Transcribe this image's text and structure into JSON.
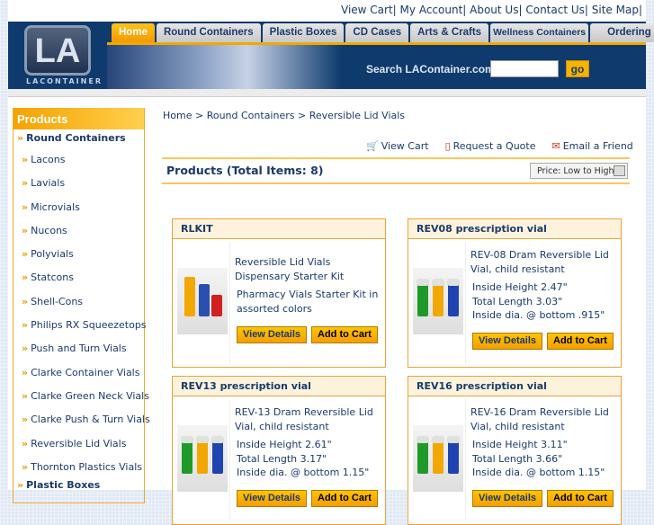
{
  "top_links": [
    "View Cart|",
    "My Account|",
    "About Us|",
    "Contact Us|",
    "Site Map|"
  ],
  "logo": {
    "mark": "LA",
    "text": "LACONTAINER"
  },
  "tabs": [
    "Home",
    "Round Containers",
    "Plastic Boxes",
    "CD Cases",
    "Arts & Crafts",
    "Wellness Containers",
    "Ordering"
  ],
  "search": {
    "label": "Search LAContainer.com",
    "value": "",
    "button": "go"
  },
  "sidebar": {
    "title": "Products",
    "category": "Round Containers",
    "items": [
      "Lacons",
      "Lavials",
      "Microvials",
      "Nucons",
      "Polyvials",
      "Statcons",
      "Shell-Cons",
      "Philips RX Squeezetops",
      "Push and Turn Vials",
      "Clarke Container Vials",
      "Clarke Green Neck Vials",
      "Clarke Push & Turn Vials",
      "Reversible Lid Vials",
      "Thornton Plastics Vials"
    ],
    "next_category": "Plastic Boxes"
  },
  "breadcrumb": "Home > Round Containers > Reversible Lid Vials",
  "actions": {
    "view_cart": "View Cart",
    "quote": "Request a Quote",
    "email": "Email a Friend"
  },
  "products_title": "Products (Total Items: 8)",
  "sort": "Price: Low to High",
  "buttons": {
    "details": "View Details",
    "cart": "Add to Cart"
  },
  "products": [
    {
      "code": "RLKIT",
      "name": "Reversible Lid Vials Dispensary Starter Kit",
      "specs": [
        "Pharmacy Vials Starter Kit in assorted colors"
      ]
    },
    {
      "code": "REV08 prescription vial",
      "name": "REV-08 Dram Reversible Lid Vial, child resistant",
      "specs": [
        "Inside Height 2.47\"",
        "Total Length 3.03\"",
        "Inside dia. @ bottom .915\""
      ]
    },
    {
      "code": "REV13 prescription vial",
      "name": "REV-13 Dram Reversible Lid Vial, child resistant",
      "specs": [
        "Inside Height 2.61\"",
        "Total Length 3.17\"",
        "Inside dia. @ bottom 1.15\""
      ]
    },
    {
      "code": "REV16 prescription vial",
      "name": "REV-16 Dram Reversible Lid Vial, child resistant",
      "specs": [
        "Inside Height 3.11\"",
        "Total Length 3.66\"",
        "Inside dia. @ bottom 1.15\""
      ]
    }
  ]
}
